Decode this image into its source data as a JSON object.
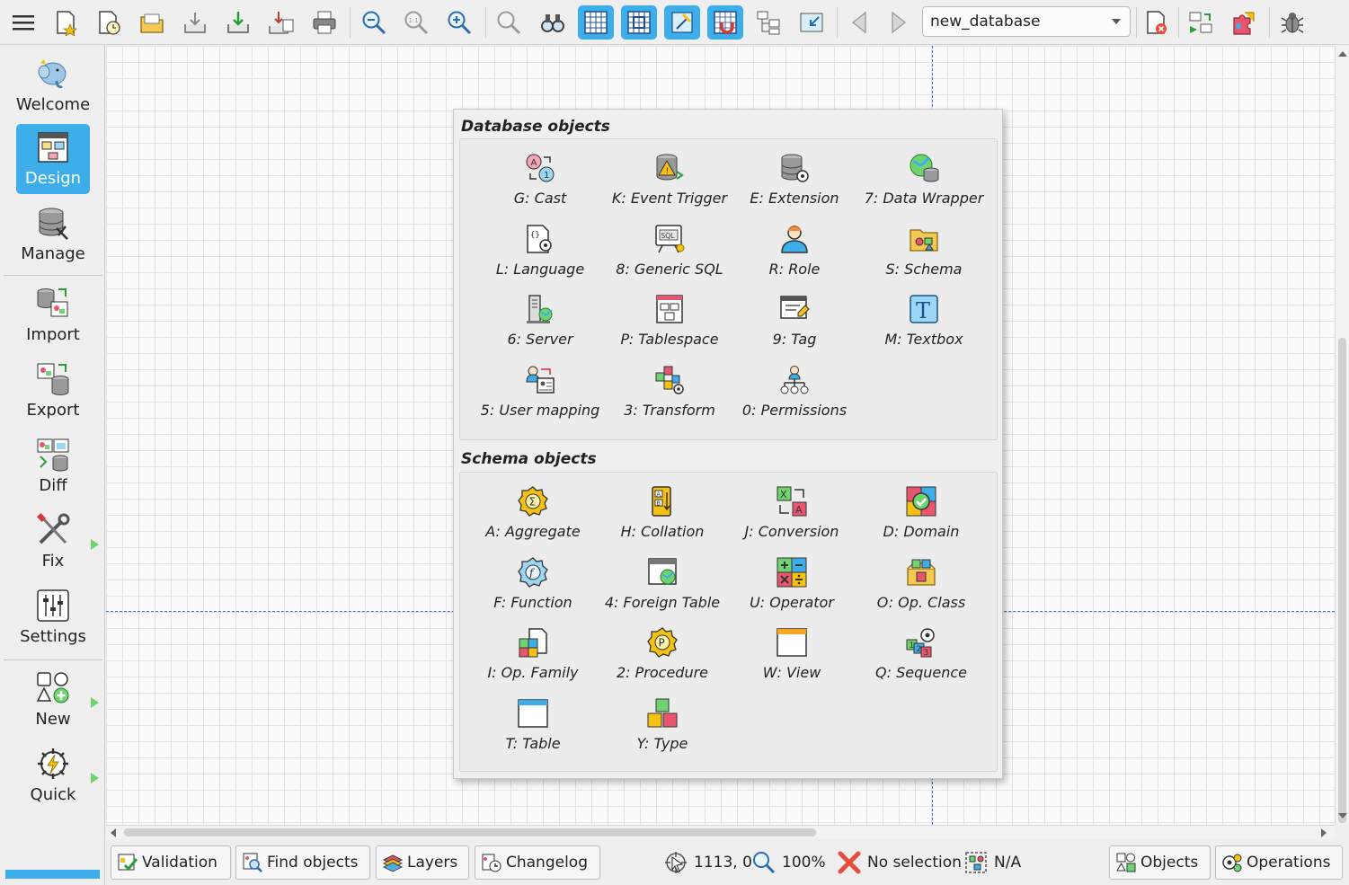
{
  "toolbar": {
    "database_combo": "new_database",
    "buttons": [
      {
        "name": "main-menu-icon"
      },
      {
        "name": "new-model-icon"
      },
      {
        "name": "recent-models-icon"
      },
      {
        "name": "open-icon"
      },
      {
        "name": "save-icon"
      },
      {
        "name": "save-as-icon"
      },
      {
        "name": "save-all-icon"
      },
      {
        "name": "print-icon"
      },
      {
        "name": "zoom-out-icon"
      },
      {
        "name": "zoom-normal-icon"
      },
      {
        "name": "zoom-in-icon"
      },
      {
        "name": "zoom-area-icon"
      },
      {
        "name": "find-icon"
      },
      {
        "name": "show-grid-icon"
      },
      {
        "name": "align-grid-icon"
      },
      {
        "name": "delimiters-icon"
      },
      {
        "name": "magnet-icon"
      },
      {
        "name": "arrange-icon"
      },
      {
        "name": "fit-window-icon"
      },
      {
        "name": "undo-icon"
      },
      {
        "name": "redo-icon"
      },
      {
        "name": "close-model-icon"
      },
      {
        "name": "swap-icon"
      },
      {
        "name": "plugins-icon"
      },
      {
        "name": "bug-icon"
      }
    ]
  },
  "sidebar": {
    "welcome": "Welcome",
    "design": "Design",
    "manage": "Manage",
    "import": "Import",
    "export": "Export",
    "diff": "Diff",
    "fix": "Fix",
    "settings": "Settings",
    "new": "New",
    "quick": "Quick"
  },
  "popup": {
    "database_title": "Database objects",
    "database_objects": [
      {
        "label": "G: Cast",
        "icon": "cast-icon"
      },
      {
        "label": "K: Event Trigger",
        "icon": "event-trigger-icon"
      },
      {
        "label": "E: Extension",
        "icon": "extension-icon"
      },
      {
        "label": "7: Data Wrapper",
        "icon": "data-wrapper-icon"
      },
      {
        "label": "L: Language",
        "icon": "language-icon"
      },
      {
        "label": "8: Generic SQL",
        "icon": "generic-sql-icon"
      },
      {
        "label": "R: Role",
        "icon": "role-icon"
      },
      {
        "label": "S: Schema",
        "icon": "schema-icon"
      },
      {
        "label": "6: Server",
        "icon": "server-icon"
      },
      {
        "label": "P: Tablespace",
        "icon": "tablespace-icon"
      },
      {
        "label": "9: Tag",
        "icon": "tag-icon"
      },
      {
        "label": "M: Textbox",
        "icon": "textbox-icon"
      },
      {
        "label": "5: User mapping",
        "icon": "user-mapping-icon"
      },
      {
        "label": "3: Transform",
        "icon": "transform-icon"
      },
      {
        "label": "0: Permissions",
        "icon": "permissions-icon"
      }
    ],
    "schema_title": "Schema objects",
    "schema_objects": [
      {
        "label": "A: Aggregate",
        "icon": "aggregate-icon"
      },
      {
        "label": "H: Collation",
        "icon": "collation-icon"
      },
      {
        "label": "J: Conversion",
        "icon": "conversion-icon"
      },
      {
        "label": "D: Domain",
        "icon": "domain-icon"
      },
      {
        "label": "F: Function",
        "icon": "function-icon"
      },
      {
        "label": "4: Foreign Table",
        "icon": "foreign-table-icon"
      },
      {
        "label": "U: Operator",
        "icon": "operator-icon"
      },
      {
        "label": "O: Op. Class",
        "icon": "op-class-icon"
      },
      {
        "label": "I: Op. Family",
        "icon": "op-family-icon"
      },
      {
        "label": "2: Procedure",
        "icon": "procedure-icon"
      },
      {
        "label": "W: View",
        "icon": "view-icon"
      },
      {
        "label": "Q: Sequence",
        "icon": "sequence-icon"
      },
      {
        "label": "T: Table",
        "icon": "table-icon"
      },
      {
        "label": "Y: Type",
        "icon": "type-icon"
      }
    ]
  },
  "statusbar": {
    "validation": "Validation",
    "find_objects": "Find objects",
    "layers": "Layers",
    "changelog": "Changelog",
    "position": "1113, 0",
    "zoom": "100%",
    "selection": "No selection",
    "selection_size": "N/A",
    "objects": "Objects",
    "operations": "Operations"
  },
  "colors": {
    "accent": "#3daee9",
    "guide": "#3b6fd4",
    "arrow_green": "#6fd36f"
  }
}
